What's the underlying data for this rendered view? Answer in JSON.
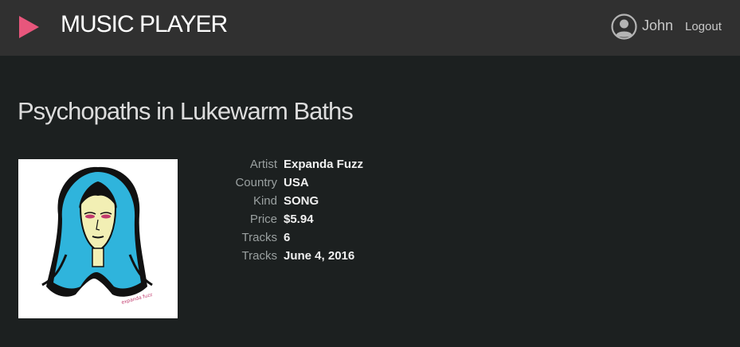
{
  "header": {
    "app_title": "MUSIC PLAYER",
    "logo_icon": "play-icon",
    "logo_color": "#e8567c",
    "user": {
      "avatar_icon": "user-avatar-icon",
      "name": "John",
      "logout_label": "Logout"
    }
  },
  "album": {
    "title": "Psychopaths in Lukewarm Baths",
    "cover_icon": "album-cover-image",
    "cover_signature": "expanda fuzz",
    "details": [
      {
        "label": "Artist",
        "value": "Expanda Fuzz"
      },
      {
        "label": "Country",
        "value": "USA"
      },
      {
        "label": "Kind",
        "value": "SONG"
      },
      {
        "label": "Price",
        "value": "$5.94"
      },
      {
        "label": "Tracks",
        "value": "6"
      },
      {
        "label": "Tracks",
        "value": "June 4, 2016"
      }
    ]
  }
}
